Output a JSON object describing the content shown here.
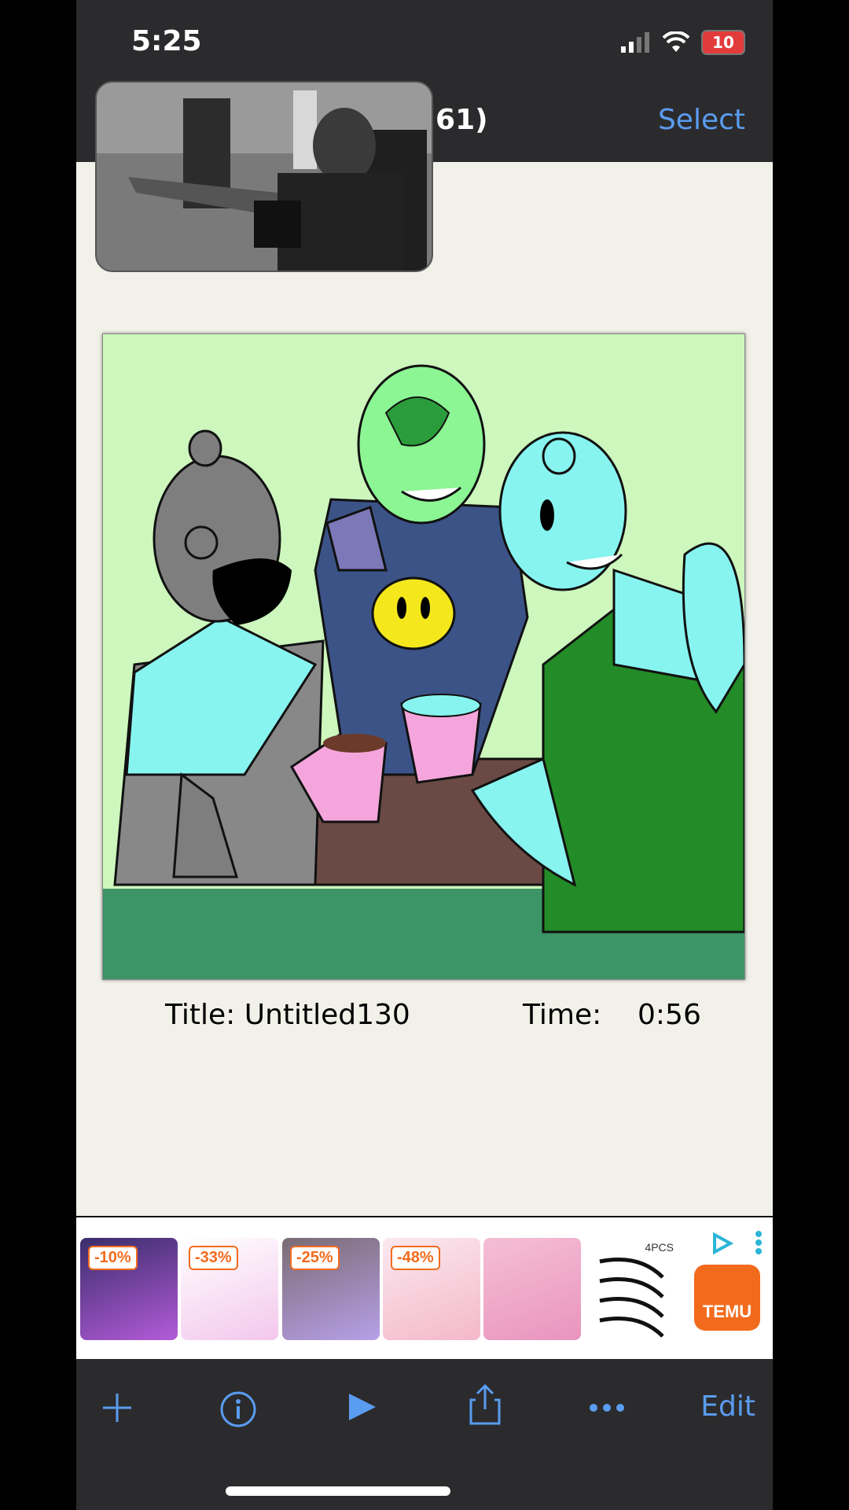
{
  "status": {
    "time": "5:25",
    "battery": "10"
  },
  "nav": {
    "title": "ery (61)",
    "select_label": "Select"
  },
  "drawing": {
    "title_caption": "Title: Untitled130",
    "time_caption": "Time:    0:56"
  },
  "ad": {
    "discounts": [
      "-10%",
      "-33%",
      "-25%",
      "-48%"
    ],
    "pack_label": "4PCS",
    "brand": "TEMU"
  },
  "toolbar": {
    "edit_label": "Edit"
  },
  "colors": {
    "accent": "#5a9cf0",
    "bg_dark": "#2b2b2d",
    "paper": "#f2f1e9",
    "temu_orange": "#f26b1d"
  }
}
